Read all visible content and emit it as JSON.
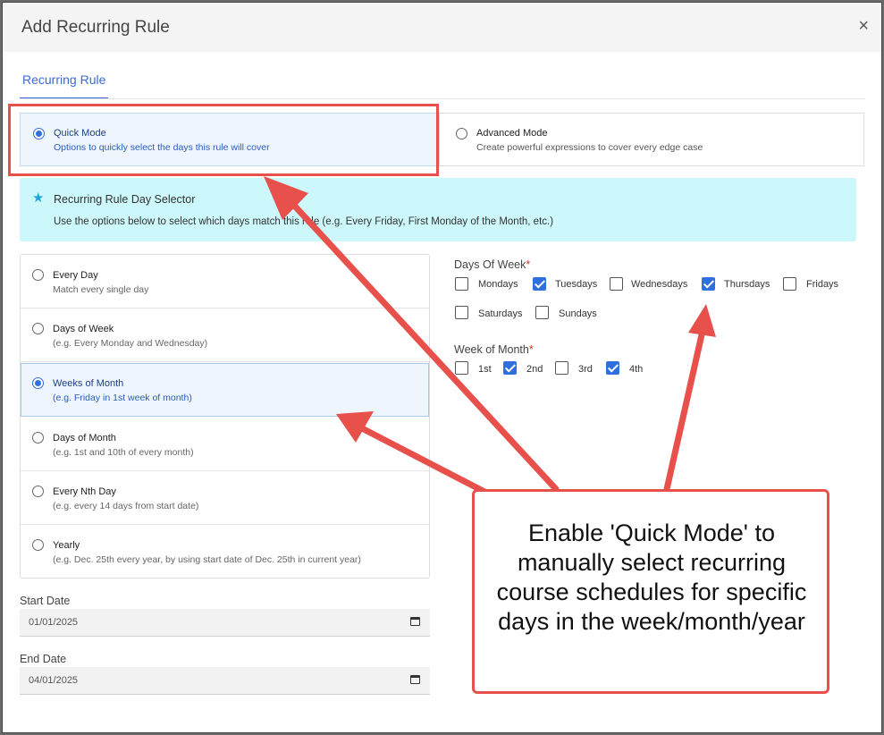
{
  "modal": {
    "title": "Add Recurring Rule",
    "close_label": "×"
  },
  "tabs": [
    {
      "label": "Recurring Rule",
      "active": true
    }
  ],
  "modes": [
    {
      "title": "Quick Mode",
      "description": "Options to quickly select the days this rule will cover",
      "selected": true
    },
    {
      "title": "Advanced Mode",
      "description": "Create powerful expressions to cover every edge case",
      "selected": false
    }
  ],
  "info": {
    "icon": "star-icon",
    "title": "Recurring Rule Day Selector",
    "text": "Use the options below to select which days match this rule (e.g. Every Friday, First Monday of the Month, etc.)"
  },
  "options": [
    {
      "title": "Every Day",
      "description": "Match every single day",
      "selected": false
    },
    {
      "title": "Days of Week",
      "description": "(e.g. Every Monday and Wednesday)",
      "selected": false
    },
    {
      "title": "Weeks of Month",
      "description": "(e.g. Friday in 1st week of month)",
      "selected": true
    },
    {
      "title": "Days of Month",
      "description": "(e.g. 1st and 10th of every month)",
      "selected": false
    },
    {
      "title": "Every Nth Day",
      "description": "(e.g. every 14 days from start date)",
      "selected": false
    },
    {
      "title": "Yearly",
      "description": "(e.g. Dec. 25th every year, by using start date of Dec. 25th in current year)",
      "selected": false
    }
  ],
  "start_date": {
    "label": "Start Date",
    "value": "01/01/2025"
  },
  "end_date": {
    "label": "End Date",
    "value": "04/01/2025"
  },
  "days_of_week": {
    "label": "Days Of Week",
    "required_mark": "*",
    "days": [
      {
        "label": "Mondays",
        "checked": false
      },
      {
        "label": "Tuesdays",
        "checked": true
      },
      {
        "label": "Wednesdays",
        "checked": false
      },
      {
        "label": "Thursdays",
        "checked": true
      },
      {
        "label": "Fridays",
        "checked": false
      },
      {
        "label": "Saturdays",
        "checked": false
      },
      {
        "label": "Sundays",
        "checked": false
      }
    ]
  },
  "week_of_month": {
    "label": "Week of Month",
    "required_mark": "*",
    "weeks": [
      {
        "label": "1st",
        "checked": false
      },
      {
        "label": "2nd",
        "checked": true
      },
      {
        "label": "3rd",
        "checked": false
      },
      {
        "label": "4th",
        "checked": true
      }
    ]
  },
  "callout": {
    "text": "Enable 'Quick Mode' to manually select recurring course schedules for specific days in the week/month/year"
  },
  "colors": {
    "accent": "#2f6fde",
    "annotation": "#e8504c",
    "info_bg": "#ccf7fb",
    "selected_bg": "#eef5fc"
  }
}
